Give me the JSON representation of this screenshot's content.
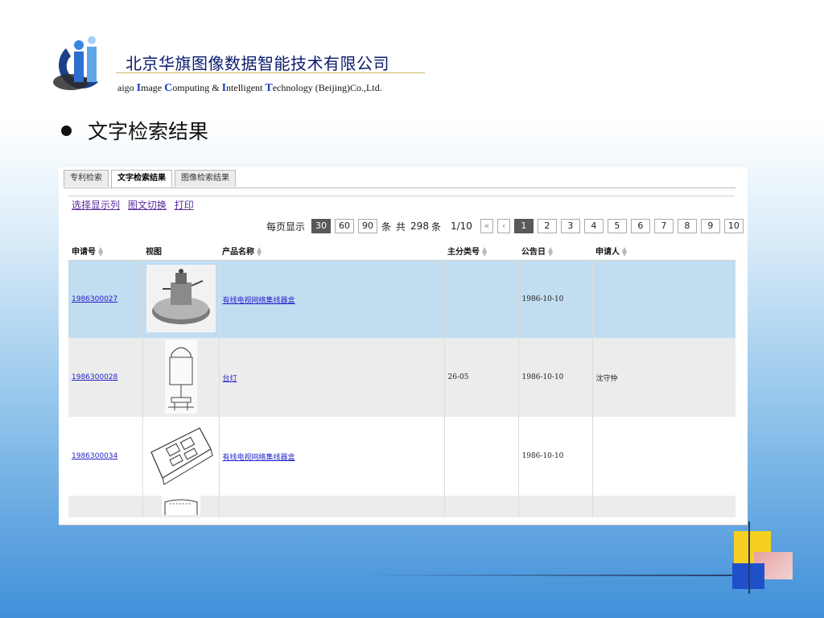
{
  "header": {
    "company_cn": "北京华旗图像数据智能技术有限公司",
    "company_en_parts": [
      {
        "t": "aigo ",
        "cap": false
      },
      {
        "t": "I",
        "cap": true
      },
      {
        "t": "mage ",
        "cap": false
      },
      {
        "t": "C",
        "cap": true
      },
      {
        "t": "omputing & ",
        "cap": false
      },
      {
        "t": "I",
        "cap": true
      },
      {
        "t": "ntelligent ",
        "cap": false
      },
      {
        "t": "T",
        "cap": true
      },
      {
        "t": "echnology (Beijing)Co.,Ltd.",
        "cap": false
      }
    ],
    "bullet": "文字检索结果"
  },
  "app": {
    "tabs": [
      {
        "label": "专利检索",
        "active": false
      },
      {
        "label": "文字检索结果",
        "active": true
      },
      {
        "label": "图像检索结果",
        "active": false
      }
    ],
    "actions": [
      "选择显示列",
      "图文切换",
      "打印"
    ],
    "pager": {
      "per_page_label": "每页显示",
      "sizes": [
        "30",
        "60",
        "90"
      ],
      "selected_size": "30",
      "unit": "条",
      "total_prefix": "共",
      "total": "298",
      "total_unit": "条",
      "page_info": "1/10",
      "first": "«",
      "prev": "‹",
      "pages": [
        "1",
        "2",
        "3",
        "4",
        "5",
        "6",
        "7",
        "8",
        "9",
        "10"
      ],
      "current_page": "1",
      "next": "›",
      "last": "»"
    },
    "columns": [
      {
        "label": "申请号",
        "sortable": true
      },
      {
        "label": "视图",
        "sortable": false
      },
      {
        "label": "产品名称",
        "sortable": true
      },
      {
        "label": "主分类号",
        "sortable": true
      },
      {
        "label": "公告日",
        "sortable": true
      },
      {
        "label": "申请人",
        "sortable": true
      }
    ],
    "sort_icon": "sort-updown-icon",
    "rows": [
      {
        "app_no": "1986300027",
        "thumb": "machine-photo-thumb",
        "product": "有线电视网络集线器盒",
        "class": "",
        "date": "1986-10-10",
        "applicant": ""
      },
      {
        "app_no": "1986300028",
        "thumb": "desk-lamp-drawing-thumb",
        "product": "台灯",
        "class": "26-05",
        "date": "1986-10-10",
        "applicant": "沈守仲"
      },
      {
        "app_no": "1986300034",
        "thumb": "box-drawing-thumb",
        "product": "有线电视网络集线器盒",
        "class": "",
        "date": "1986-10-10",
        "applicant": ""
      },
      {
        "app_no": "",
        "thumb": "partial-drawing-thumb",
        "product": "",
        "class": "",
        "date": "",
        "applicant": ""
      }
    ]
  },
  "colors": {
    "link": "#2323c8",
    "action_link": "#5a2aa0",
    "row_highlight": "#c2dcf0",
    "row_alt": "#ececec",
    "page_selected": "#5a5a5a"
  }
}
